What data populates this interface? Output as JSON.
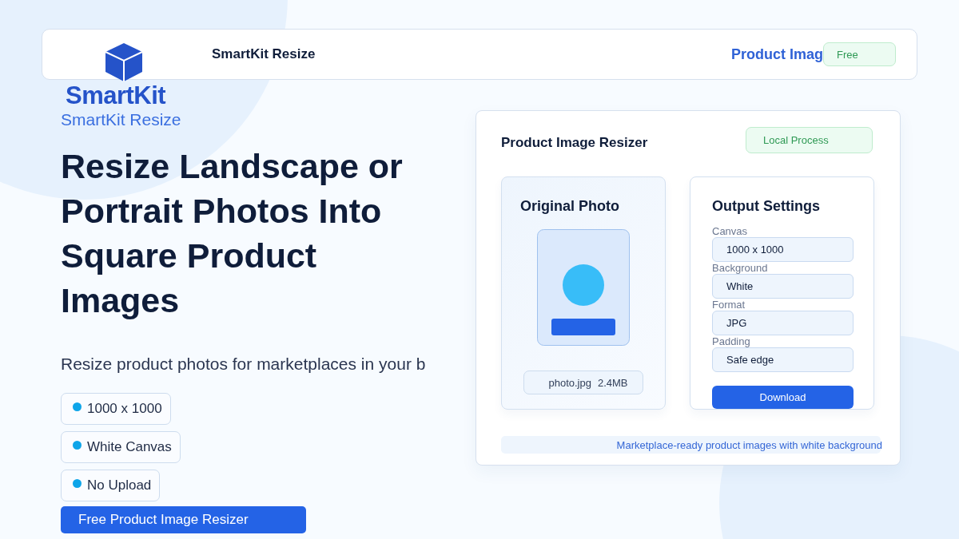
{
  "header": {
    "title": "SmartKit Resize",
    "nav_link": "Product Imag",
    "badge": "Free"
  },
  "logo": {
    "wordmark": "SmartKit",
    "tagline": "SmartKit Resize"
  },
  "hero": {
    "title": "Resize Landscape or Portrait Photos Into Square Product Images",
    "subtitle": "Resize product photos for marketplaces in your b",
    "chips": [
      {
        "label": "1000 x 1000",
        "color": "#0ea5e9"
      },
      {
        "label": "White Canvas",
        "color": "#0ea5e9"
      },
      {
        "label": "No Upload",
        "color": "#0ea5e9"
      }
    ],
    "cta": "Free Product Image Resizer"
  },
  "panel": {
    "title": "Product Image Resizer",
    "badge": "Local Process",
    "original": {
      "title": "Original Photo",
      "file_name": "photo.jpg",
      "file_size": "2.4MB"
    },
    "settings": {
      "title": "Output Settings",
      "fields": [
        {
          "label": "Canvas",
          "value": "1000 x 1000"
        },
        {
          "label": "Background",
          "value": "White"
        },
        {
          "label": "Format",
          "value": "JPG"
        },
        {
          "label": "Padding",
          "value": "Safe edge"
        }
      ],
      "button": "Download"
    },
    "footer": "Marketplace-ready product images with white background"
  }
}
